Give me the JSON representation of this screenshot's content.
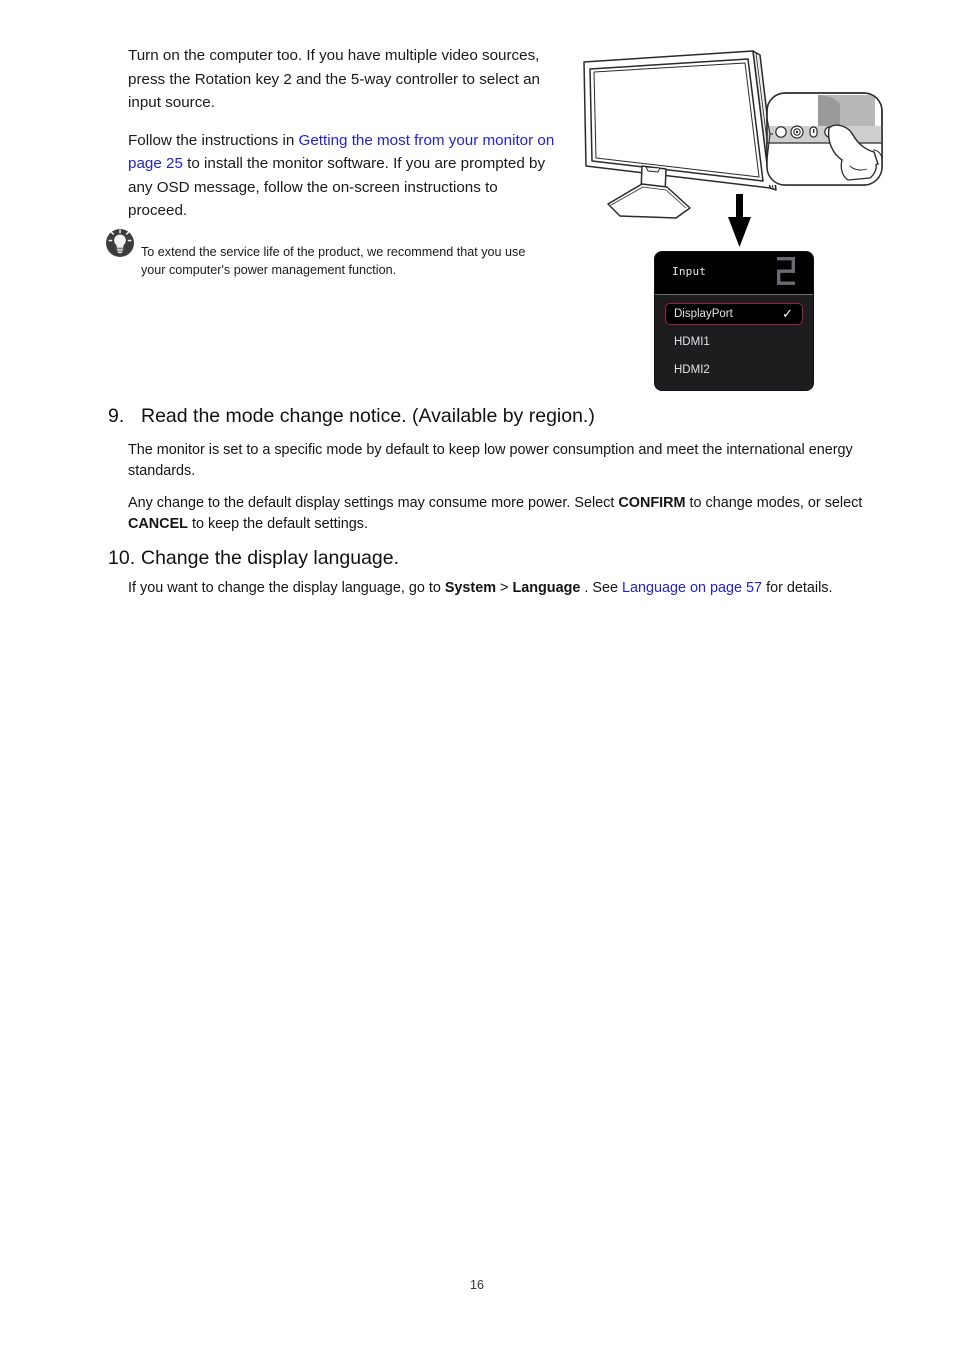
{
  "document": {
    "page_number": "16"
  },
  "intro": {
    "para1_part1": "Turn on the computer too. If you have multiple video sources, press the Rotation key 2 and the 5-way controller to select an input source.",
    "para2_part1": "Follow the instructions in ",
    "para2_link": "Getting the most from your monitor on page 25",
    "para2_part2": " to install the monitor software. If you are prompted by any OSD message, follow the on-screen instructions to proceed."
  },
  "tip": {
    "icon": "lightbulb-icon",
    "text": "To extend the service life of the product, we recommend that you use your computer's power management function."
  },
  "illustration": {
    "name": "monitor-with-control-keys-illustration",
    "arrow": "down-arrow-icon",
    "callout_buttons": [
      "key-1",
      "five-way-controller",
      "key-3",
      "key-pressed"
    ]
  },
  "osd": {
    "title": "Input",
    "key_indicator": "2",
    "items": [
      {
        "label": "DisplayPort",
        "selected": true,
        "check": "✓"
      },
      {
        "label": "HDMI1",
        "selected": false,
        "check": ""
      },
      {
        "label": "HDMI2",
        "selected": false,
        "check": ""
      }
    ],
    "colors": {
      "header_bg": "#000000",
      "body_bg": "#1d1d1f",
      "selected_border": "#9e2040",
      "text": "#e3e3e8"
    }
  },
  "sections": [
    {
      "number": "9.",
      "title": "Read the mode change notice. (Available by region.)",
      "paragraphs": [
        {
          "part1": "The monitor is set to a specific mode by default to keep low power consumption and meet the international energy standards.",
          "bold1": "",
          "part2": "",
          "bold2": "",
          "part3": ""
        },
        {
          "part1": "Any change to the default display settings may consume more power. Select ",
          "bold1": "CONFIRM",
          "part2": " to change modes, or select ",
          "bold2": "CANCEL",
          "part3": " to keep the default settings."
        }
      ]
    },
    {
      "number": "10.",
      "title": "Change the display language.",
      "paragraphs": [
        {
          "part1": "If you want to change the display language, go to ",
          "bold1": "System",
          "part2": " > ",
          "bold2": "Language",
          "part3": " . See ",
          "link": "Language on page 57",
          "part4": " for details."
        }
      ]
    }
  ],
  "colors": {
    "link": "#2222dd",
    "text": "#111111"
  }
}
